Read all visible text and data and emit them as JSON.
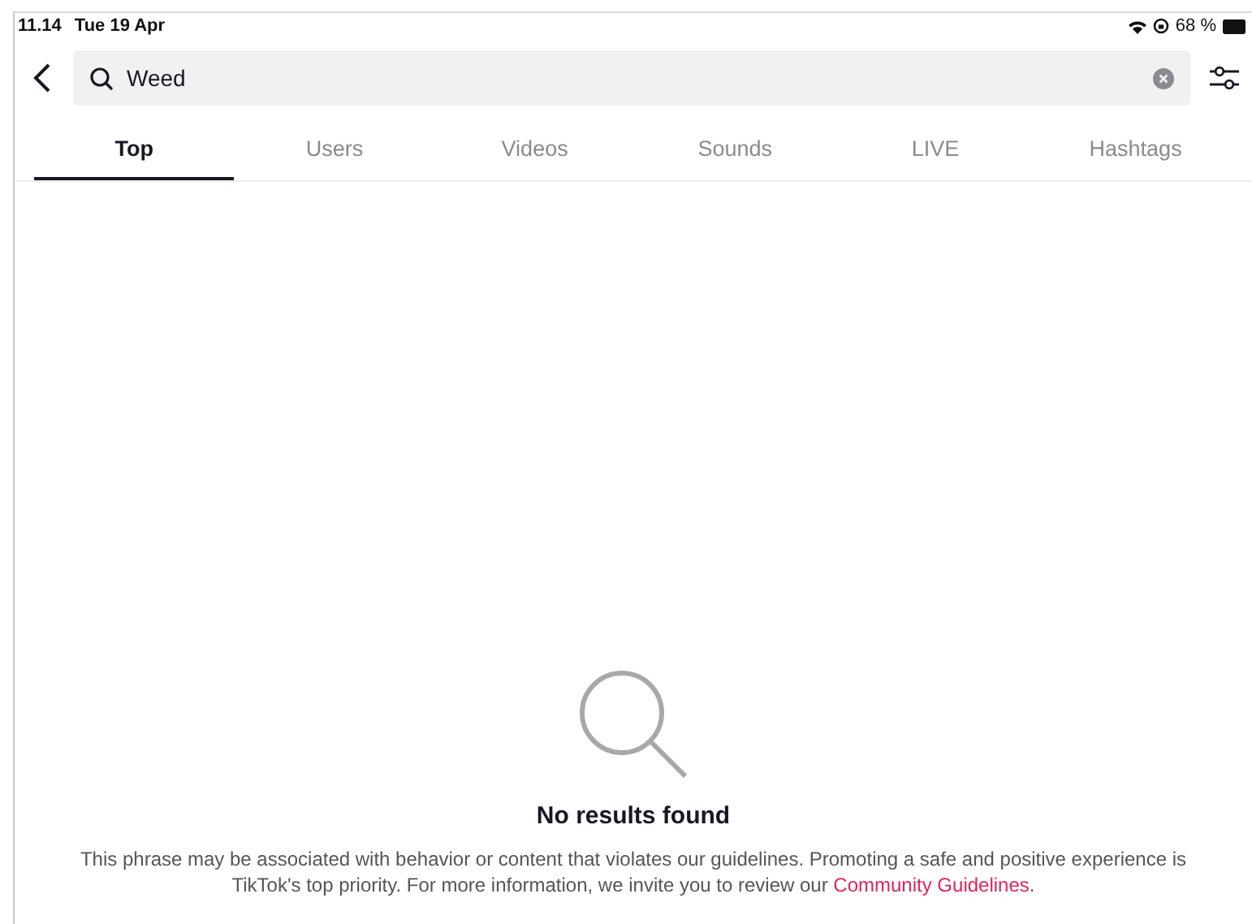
{
  "status_bar": {
    "time": "11.14",
    "date": "Tue 19 Apr",
    "battery": "68 %"
  },
  "search": {
    "value": "Weed"
  },
  "tabs": [
    {
      "label": "Top",
      "selected": true
    },
    {
      "label": "Users",
      "selected": false
    },
    {
      "label": "Videos",
      "selected": false
    },
    {
      "label": "Sounds",
      "selected": false
    },
    {
      "label": "LIVE",
      "selected": false
    },
    {
      "label": "Hashtags",
      "selected": false
    }
  ],
  "empty_state": {
    "title": "No results found",
    "message": "This phrase may be associated with behavior or content that violates our guidelines. Promoting a safe and positive experience is TikTok's top priority. For more information, we invite you to review our ",
    "link": "Community Guidelines",
    "message_end": "."
  }
}
